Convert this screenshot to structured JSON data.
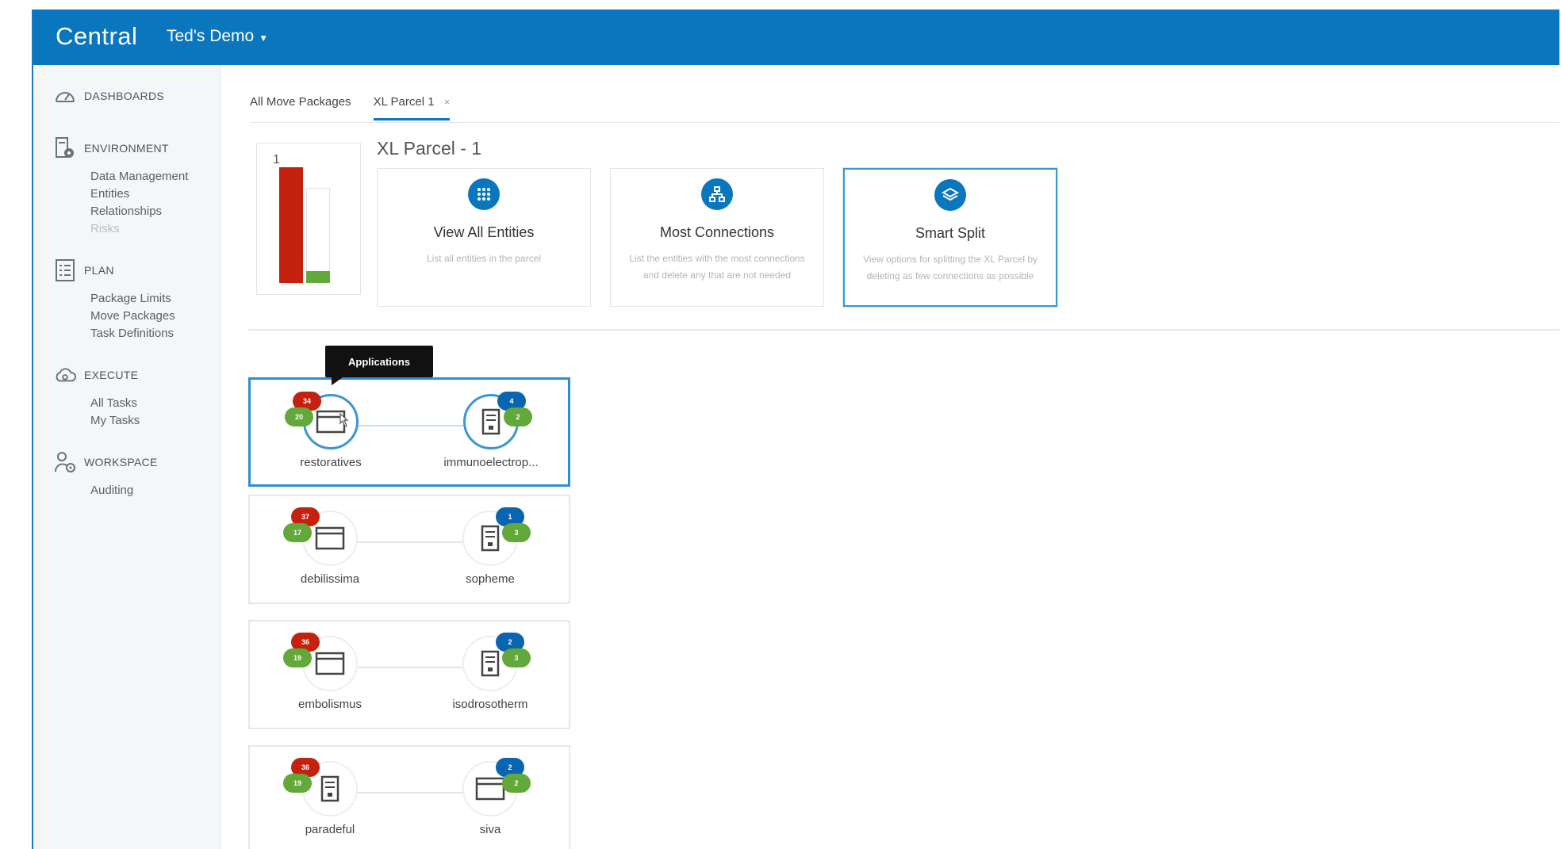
{
  "app": {
    "brand": "Central",
    "workspace": "Ted's Demo"
  },
  "sidebar": {
    "sections": [
      {
        "label": "DASHBOARDS",
        "icon": "gauge-icon",
        "items": []
      },
      {
        "label": "ENVIRONMENT",
        "icon": "server-gear-icon",
        "items": [
          "Data Management",
          "Entities",
          "Relationships",
          "Risks"
        ]
      },
      {
        "label": "PLAN",
        "icon": "checklist-icon",
        "items": [
          "Package Limits",
          "Move Packages",
          "Task Definitions"
        ]
      },
      {
        "label": "EXECUTE",
        "icon": "cloud-gear-icon",
        "items": [
          "All Tasks",
          "My Tasks"
        ]
      },
      {
        "label": "WORKSPACE",
        "icon": "user-gear-icon",
        "items": [
          "Auditing"
        ]
      }
    ]
  },
  "tabs": [
    {
      "label": "All Move Packages",
      "active": false
    },
    {
      "label": "XL Parcel 1",
      "active": true,
      "close": "×"
    }
  ],
  "meter": {
    "count": "1",
    "red_fraction": 1.0,
    "green_fraction": 0.1
  },
  "parcel_title": "XL Parcel - 1",
  "cards": [
    {
      "title": "View All Entities",
      "desc": "List all entities in the parcel",
      "icon": "grid-icon"
    },
    {
      "title": "Most Connections",
      "desc": "List the entities with the most connections and delete any that are not needed",
      "icon": "network-icon"
    },
    {
      "title": "Smart Split",
      "desc": "View options for splitting the XL Parcel by deleting as few connections as possible",
      "icon": "layers-icon",
      "selected": true
    }
  ],
  "tooltip": "Applications",
  "pairs": [
    {
      "left": {
        "name": "restoratives",
        "red": "34",
        "green": "20",
        "type": "window"
      },
      "right": {
        "name": "immunoelectrop...",
        "blue": "4",
        "green": "2",
        "type": "server"
      },
      "selected": true
    },
    {
      "left": {
        "name": "debilissima",
        "red": "37",
        "green": "17",
        "type": "window"
      },
      "right": {
        "name": "sopheme",
        "blue": "1",
        "green": "3",
        "type": "server"
      }
    },
    {
      "left": {
        "name": "embolismus",
        "red": "36",
        "green": "19",
        "type": "window"
      },
      "right": {
        "name": "isodrosotherm",
        "blue": "2",
        "green": "3",
        "type": "server"
      }
    },
    {
      "left": {
        "name": "paradeful",
        "red": "36",
        "green": "19",
        "type": "server"
      },
      "right": {
        "name": "siva",
        "blue": "2",
        "green": "2",
        "type": "window"
      }
    }
  ]
}
